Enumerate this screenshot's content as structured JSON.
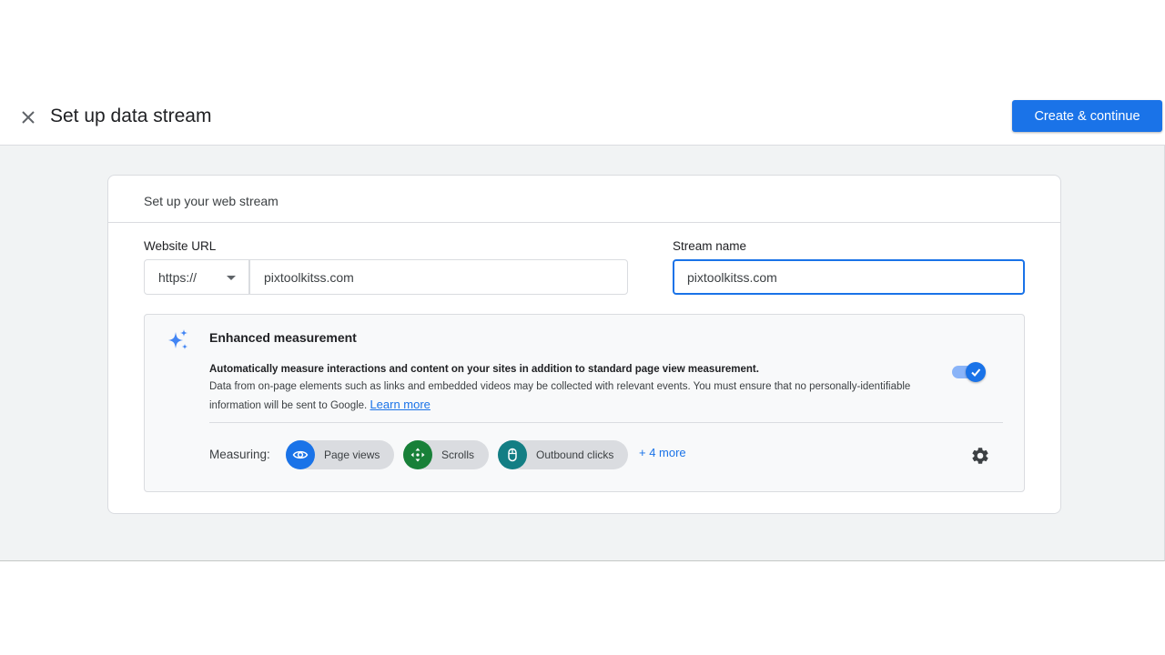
{
  "header": {
    "title": "Set up data stream",
    "primary_button": "Create & continue"
  },
  "card": {
    "heading": "Set up your web stream",
    "website_url": {
      "label": "Website URL",
      "protocol": "https://",
      "value": "pixtoolkitss.com"
    },
    "stream_name": {
      "label": "Stream name",
      "value": "pixtoolkitss.com"
    },
    "enhanced": {
      "title": "Enhanced measurement",
      "description_strong": "Automatically measure interactions and content on your sites in addition to standard page view measurement.",
      "description": "Data from on-page elements such as links and embedded videos may be collected with relevant events. You must ensure that no personally-identifiable information will be sent to Google.",
      "learn_more": "Learn more",
      "enabled": true,
      "measuring_label": "Measuring:",
      "chips": [
        {
          "label": "Page views",
          "icon": "eye-icon",
          "color": "#1a73e8"
        },
        {
          "label": "Scrolls",
          "icon": "scroll-arrows-icon",
          "color": "#188038"
        },
        {
          "label": "Outbound clicks",
          "icon": "mouse-icon",
          "color": "#137e84"
        }
      ],
      "more_link": "+ 4 more"
    }
  },
  "colors": {
    "accent": "#1a73e8",
    "background": "#f1f3f4"
  }
}
